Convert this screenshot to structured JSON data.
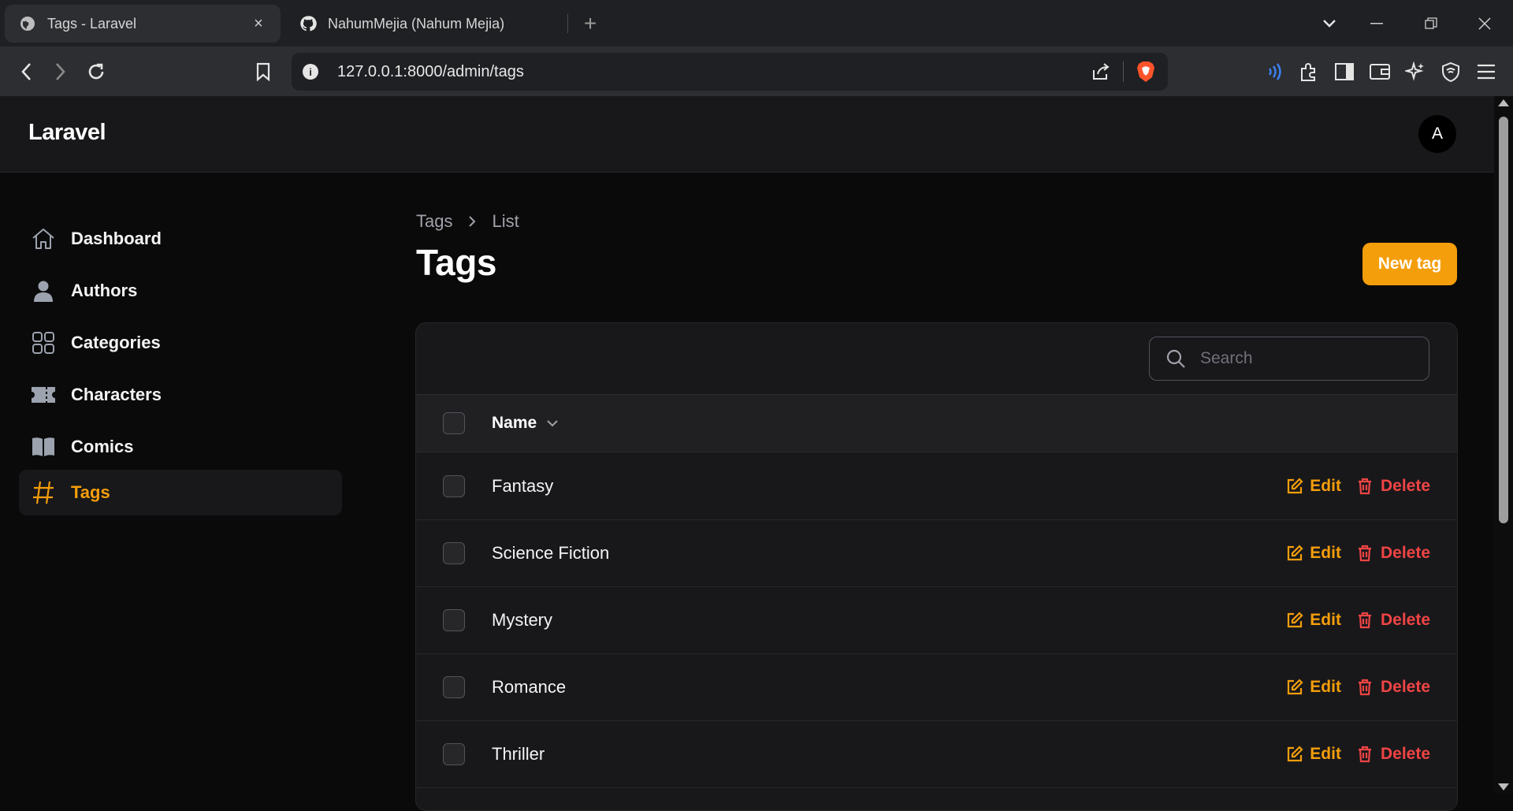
{
  "browser": {
    "tabs": [
      {
        "title": "Tags - Laravel",
        "active": true,
        "close": "×"
      },
      {
        "title": "NahumMejia (Nahum Mejia)",
        "active": false
      }
    ],
    "new_tab": "+",
    "url": "127.0.0.1:8000/admin/tags"
  },
  "app": {
    "brand": "Laravel",
    "avatar_initial": "A",
    "accent_color": "#f59e0b",
    "danger_color": "#ef4444"
  },
  "sidebar": {
    "items": [
      {
        "label": "Dashboard",
        "icon": "home-icon",
        "active": false
      },
      {
        "label": "Authors",
        "icon": "user-icon",
        "active": false
      },
      {
        "label": "Categories",
        "icon": "grid-icon",
        "active": false
      },
      {
        "label": "Characters",
        "icon": "ticket-icon",
        "active": false
      },
      {
        "label": "Comics",
        "icon": "book-icon",
        "active": false
      },
      {
        "label": "Tags",
        "icon": "hashtag-icon",
        "active": true
      }
    ]
  },
  "breadcrumb": {
    "root": "Tags",
    "current": "List"
  },
  "page": {
    "title": "Tags",
    "new_button": "New tag"
  },
  "table": {
    "search_placeholder": "Search",
    "column_name": "Name",
    "edit_label": "Edit",
    "delete_label": "Delete",
    "rows": [
      "Fantasy",
      "Science Fiction",
      "Mystery",
      "Romance",
      "Thriller"
    ]
  }
}
